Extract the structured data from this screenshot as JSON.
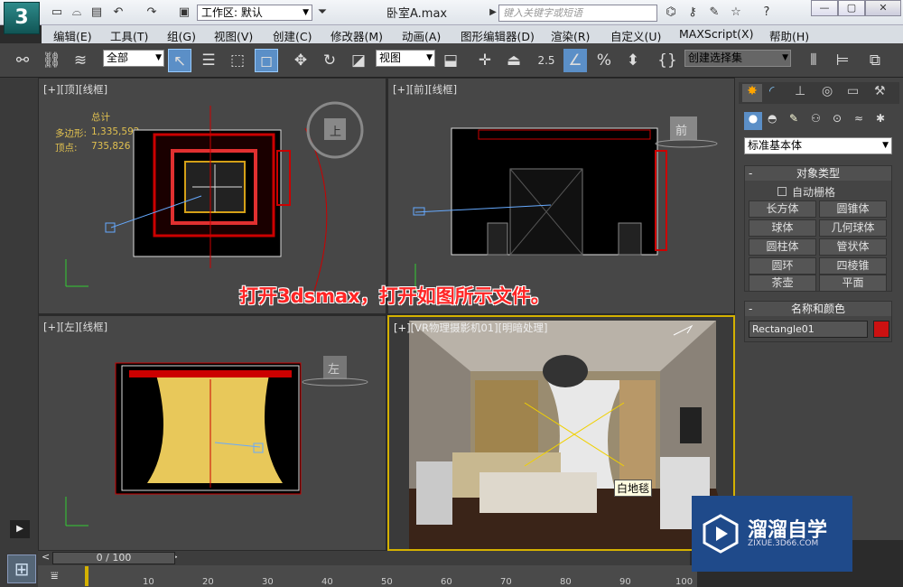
{
  "window": {
    "title": "卧室A.max",
    "workspace": "工作区: 默认",
    "search_placeholder": "键入关键字或短语",
    "minimize": "—",
    "restore": "▢",
    "close": "✕"
  },
  "menus": [
    "编辑(E)",
    "工具(T)",
    "组(G)",
    "视图(V)",
    "创建(C)",
    "修改器(M)",
    "动画(A)",
    "图形编辑器(D)",
    "渲染(R)",
    "自定义(U)",
    "MAXScript(X)",
    "帮助(H)"
  ],
  "toolbar": {
    "filter": "全部",
    "view": "视图",
    "snap_value": "2.5",
    "selection_set": "创建选择集"
  },
  "viewports": {
    "top": {
      "label": "[+][顶][线框]",
      "stats_title": "总计",
      "poly_label": "多边形:",
      "poly_value": "1,335,592",
      "vert_label": "顶点:",
      "vert_value": "735,826",
      "gizmo": "上"
    },
    "front": {
      "label": "[+][前][线框]",
      "gizmo": "前"
    },
    "left": {
      "label": "[+][左][线框]",
      "gizmo": "左"
    },
    "camera": {
      "label": "[+][VR物理摄影机01][明暗处理]",
      "tooltip": "白地毯"
    }
  },
  "caption": "打开3dsmax，打开如图所示文件。",
  "panel": {
    "dropdown": "标准基本体",
    "rollout_type": "对象类型",
    "autogrid": "自动栅格",
    "buttons": [
      "长方体",
      "圆锥体",
      "球体",
      "几何球体",
      "圆柱体",
      "管状体",
      "圆环",
      "四棱锥",
      "茶壶",
      "平面"
    ],
    "rollout_name": "名称和颜色",
    "object_name": "Rectangle01",
    "object_color": "#cc1111"
  },
  "timeline": {
    "frame": "0 / 100",
    "ticks": [
      "10",
      "20",
      "30",
      "40",
      "50",
      "60",
      "70",
      "80",
      "90",
      "100"
    ]
  },
  "watermark": {
    "brand": "溜溜自学",
    "url": "ZIXUE.3D66.COM"
  }
}
